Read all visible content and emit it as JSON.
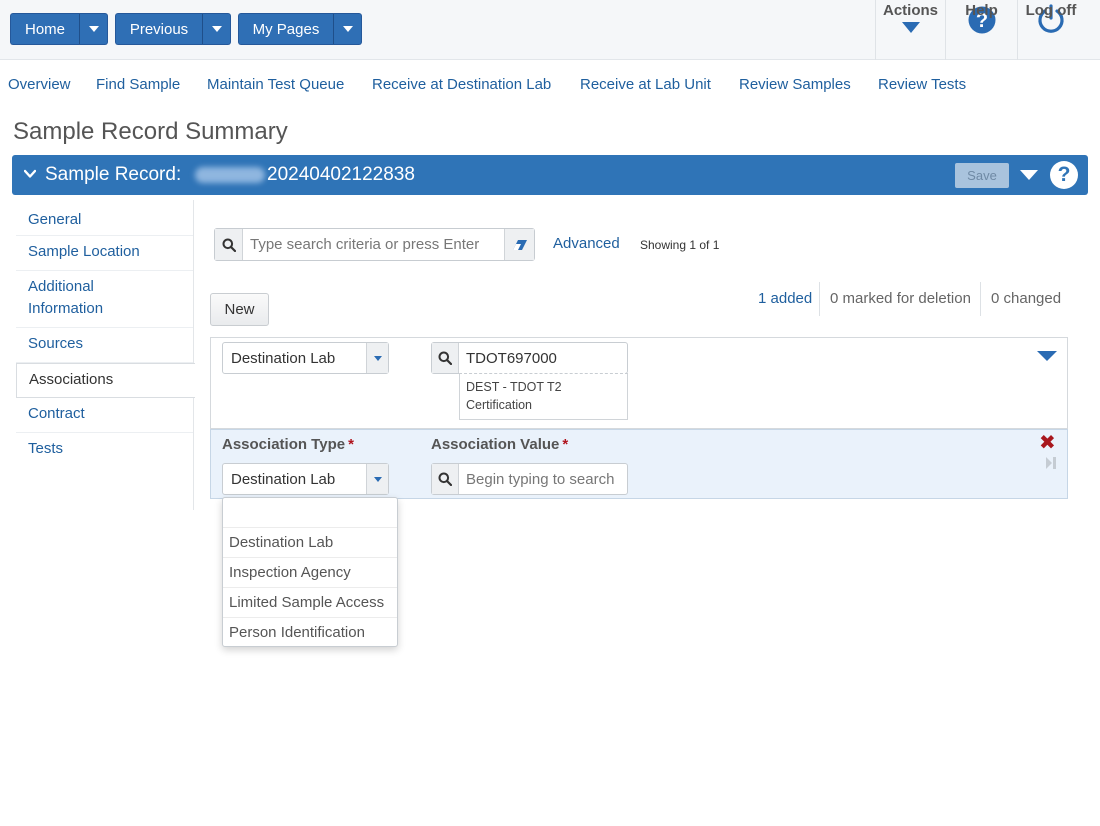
{
  "topbar": {
    "home_label": "Home",
    "previous_label": "Previous",
    "mypages_label": "My Pages",
    "actions_label": "Actions",
    "help_label": "Help",
    "logoff_label": "Log off"
  },
  "nav": {
    "links": [
      "Overview",
      "Find Sample",
      "Maintain Test Queue",
      "Receive at Destination Lab",
      "Receive at Lab Unit",
      "Review Samples",
      "Review Tests"
    ]
  },
  "page": {
    "title": "Sample Record Summary"
  },
  "record": {
    "label": "Sample Record:",
    "id": "20240402122838",
    "save_label": "Save"
  },
  "sidebar": {
    "items": [
      {
        "label": "General"
      },
      {
        "label": "Sample Location"
      },
      {
        "label": "Additional Information"
      },
      {
        "label": "Sources"
      },
      {
        "label": "Associations"
      },
      {
        "label": "Contract"
      },
      {
        "label": "Tests"
      }
    ],
    "active": "Associations"
  },
  "search": {
    "placeholder": "Type search criteria or press Enter",
    "advanced_label": "Advanced",
    "showing": "Showing 1 of 1"
  },
  "toolbar": {
    "new_label": "New",
    "added": "1 added",
    "marked_for_deletion": "0 marked for deletion",
    "changed": "0 changed"
  },
  "rows": [
    {
      "association_type": "Destination Lab",
      "association_value": "TDOT697000",
      "description_line1": "DEST - TDOT T2",
      "description_line2": "Certification"
    },
    {
      "association_type_label": "Association Type",
      "association_value_label": "Association Value",
      "required_marker": "*",
      "association_type": "Destination Lab",
      "value_placeholder": "Begin typing to search"
    }
  ],
  "dropdown": {
    "options": [
      "",
      "Destination Lab",
      "Inspection Agency",
      "Limited Sample Access",
      "Person Identification"
    ]
  },
  "colors": {
    "primary": "#2f74b7",
    "link": "#1f5f9e",
    "required": "#b0141d",
    "selected_row": "#eaf2fb"
  }
}
